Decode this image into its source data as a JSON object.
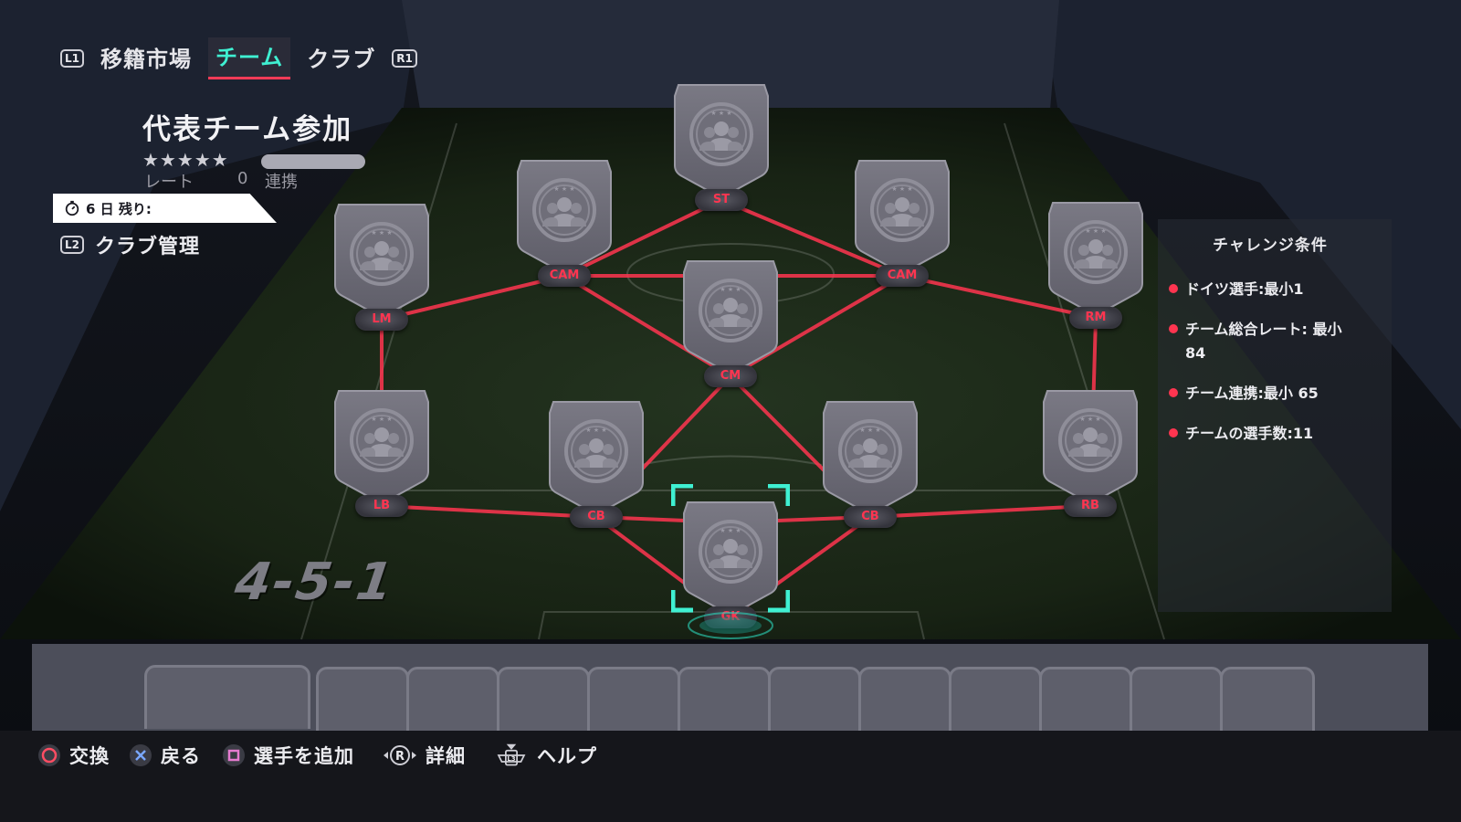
{
  "nav": {
    "left_button": "L1",
    "right_button": "R1",
    "tabs": [
      {
        "label": "移籍市場"
      },
      {
        "label": "チーム"
      },
      {
        "label": "クラブ"
      }
    ],
    "active_tab": "チーム"
  },
  "squad": {
    "title": "代表チーム参加",
    "stars": "★★★★★",
    "rating_label": "レート",
    "rating_value": "0",
    "chemistry_label": "連携",
    "timer_text": "6 日 残り:",
    "club_mgmt_button": "L2",
    "club_mgmt_label": "クラブ管理",
    "formation": "4-5-1"
  },
  "positions": [
    {
      "id": "ST",
      "label": "ST"
    },
    {
      "id": "CAM-L",
      "label": "CAM"
    },
    {
      "id": "CAM-R",
      "label": "CAM"
    },
    {
      "id": "LM",
      "label": "LM"
    },
    {
      "id": "RM",
      "label": "RM"
    },
    {
      "id": "CM",
      "label": "CM"
    },
    {
      "id": "LB",
      "label": "LB"
    },
    {
      "id": "CB-L",
      "label": "CB"
    },
    {
      "id": "CB-R",
      "label": "CB"
    },
    {
      "id": "RB",
      "label": "RB"
    },
    {
      "id": "GK",
      "label": "GK"
    }
  ],
  "selected_position": "GK",
  "challenge": {
    "title": "チャレンジ条件",
    "requirements": [
      {
        "text": "ドイツ選手:最小1",
        "cont": ""
      },
      {
        "text": "チーム総合レート: 最小",
        "cont": "84"
      },
      {
        "text": "チーム連携:最小 65",
        "cont": ""
      },
      {
        "text": "チームの選手数:11",
        "cont": ""
      }
    ]
  },
  "footer": {
    "swap": "交換",
    "back": "戻る",
    "add_player": "選手を追加",
    "details": "詳細",
    "help": "ヘルプ",
    "r_icon": "R",
    "l3_icon": "L3"
  },
  "colors": {
    "accent_teal": "#3ff0d2",
    "link_red": "#ff3550",
    "card_gray": "#6c6b76",
    "pitch_green": "#1f2a1c"
  }
}
